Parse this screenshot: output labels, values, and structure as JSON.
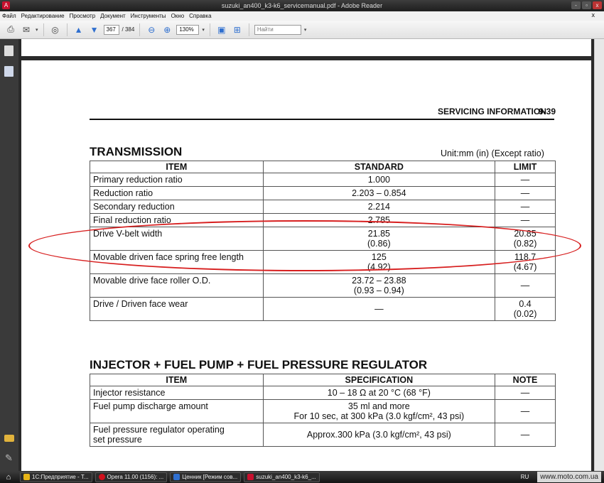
{
  "window": {
    "title": "suzuki_an400_k3-k6_servicemanual.pdf - Adobe Reader",
    "controls": [
      "-",
      "▫",
      "x"
    ]
  },
  "menu": {
    "items": [
      "Файл",
      "Редактирование",
      "Просмотр",
      "Документ",
      "Инструменты",
      "Окно",
      "Справка"
    ],
    "close": "x"
  },
  "toolbar": {
    "page_current": "367",
    "page_total": "/ 384",
    "zoom": "130%",
    "search_placeholder": "Найти"
  },
  "document": {
    "header_section": "SERVICING INFORMATION",
    "header_page": "9-39",
    "transmission": {
      "title": "TRANSMISSION",
      "unit_note": "Unit:mm (in) (Except ratio)",
      "columns": [
        "ITEM",
        "STANDARD",
        "LIMIT"
      ],
      "rows": [
        {
          "item": "Primary reduction ratio",
          "std1": "1.000",
          "std2": "",
          "lim1": "—",
          "lim2": ""
        },
        {
          "item": "Reduction ratio",
          "std1": "2.203 – 0.854",
          "std2": "",
          "lim1": "—",
          "lim2": ""
        },
        {
          "item": "Secondary reduction",
          "std1": "2.214",
          "std2": "",
          "lim1": "—",
          "lim2": ""
        },
        {
          "item": "Final reduction ratio",
          "std1": "2.785",
          "std2": "",
          "lim1": "—",
          "lim2": ""
        },
        {
          "item": "Drive V-belt width",
          "std1": "21.85",
          "std2": "(0.86)",
          "lim1": "20.85",
          "lim2": "(0.82)"
        },
        {
          "item": "Movable driven face spring free length",
          "std1": "125",
          "std2": "(4.92)",
          "lim1": "118.7",
          "lim2": "(4.67)"
        },
        {
          "item": "Movable drive face roller O.D.",
          "std1": "23.72 – 23.88",
          "std2": "(0.93 – 0.94)",
          "lim1": "—",
          "lim2": ""
        },
        {
          "item": "Drive / Driven face wear",
          "std1": "—",
          "std2": "",
          "lim1": "0.4",
          "lim2": "(0.02)"
        }
      ]
    },
    "injector": {
      "title": "INJECTOR + FUEL PUMP + FUEL PRESSURE REGULATOR",
      "columns": [
        "ITEM",
        "SPECIFICATION",
        "NOTE"
      ],
      "rows": [
        {
          "item1": "Injector resistance",
          "item2": "",
          "spec1": "10 – 18  Ω at 20 °C (68 °F)",
          "spec2": "",
          "note": "—"
        },
        {
          "item1": "Fuel pump discharge amount",
          "item2": "",
          "spec1": "35 ml and more",
          "spec2": "For 10 sec, at 300 kPa (3.0 kgf/cm², 43 psi)",
          "note": "—"
        },
        {
          "item1": "Fuel pressure regulator operating",
          "item2": "set pressure",
          "spec1": "Approx.300 kPa (3.0 kgf/cm², 43 psi)",
          "spec2": "",
          "note": "—"
        }
      ]
    }
  },
  "taskbar": {
    "items": [
      {
        "label": "1С:Предприятие - Т...",
        "color": "#e7b416"
      },
      {
        "label": "Opera 11.00 (1156): ...",
        "color": "#d0101c"
      },
      {
        "label": "Ценник [Режим сов...",
        "color": "#2f6fcf"
      },
      {
        "label": "suzuki_an400_k3-k6_...",
        "color": "#c8102e"
      }
    ],
    "lang": "RU",
    "watermark": "www.moto.com.ua"
  }
}
